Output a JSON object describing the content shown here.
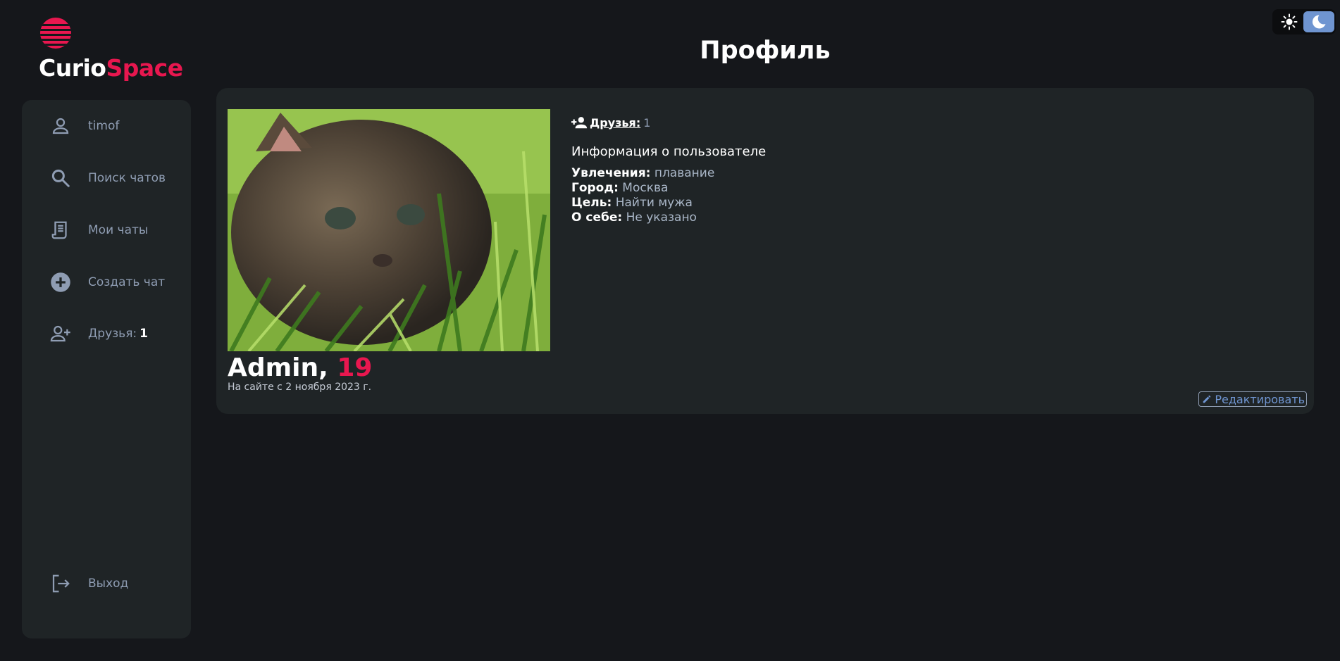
{
  "brand": {
    "part1": "Curio",
    "part2": "Space"
  },
  "page": {
    "title": "Профиль"
  },
  "sidebar": {
    "items": [
      {
        "label": "timof",
        "icon": "user-icon"
      },
      {
        "label": "Поиск чатов",
        "icon": "search-icon"
      },
      {
        "label": "Мои чаты",
        "icon": "receipt-icon"
      },
      {
        "label": "Создать чат",
        "icon": "add-circle-icon"
      },
      {
        "label": "Друзья:",
        "count": "1",
        "icon": "person-add-icon"
      }
    ],
    "logout": {
      "label": "Выход",
      "icon": "logout-icon"
    }
  },
  "theme": {
    "light_icon": "sun-icon",
    "dark_icon": "moon-icon",
    "active": "dark"
  },
  "profile": {
    "name": "Admin,",
    "age": "19",
    "joined": "На сайте с 2 ноября 2023 г.",
    "friends_label": "Друзья:",
    "friends_count": "1",
    "info_title": "Информация о пользователе",
    "fields": [
      {
        "key": "Увлечения:",
        "value": "плавание"
      },
      {
        "key": "Город:",
        "value": "Москва"
      },
      {
        "key": "Цель:",
        "value": "Найти мужа"
      },
      {
        "key": "О себе:",
        "value": "Не указано"
      }
    ],
    "edit_label": "Редактировать"
  },
  "colors": {
    "accent": "#e8174f",
    "link": "#6f95d1",
    "muted": "#8f9db3",
    "card": "#1f2426",
    "background": "#15171b"
  }
}
